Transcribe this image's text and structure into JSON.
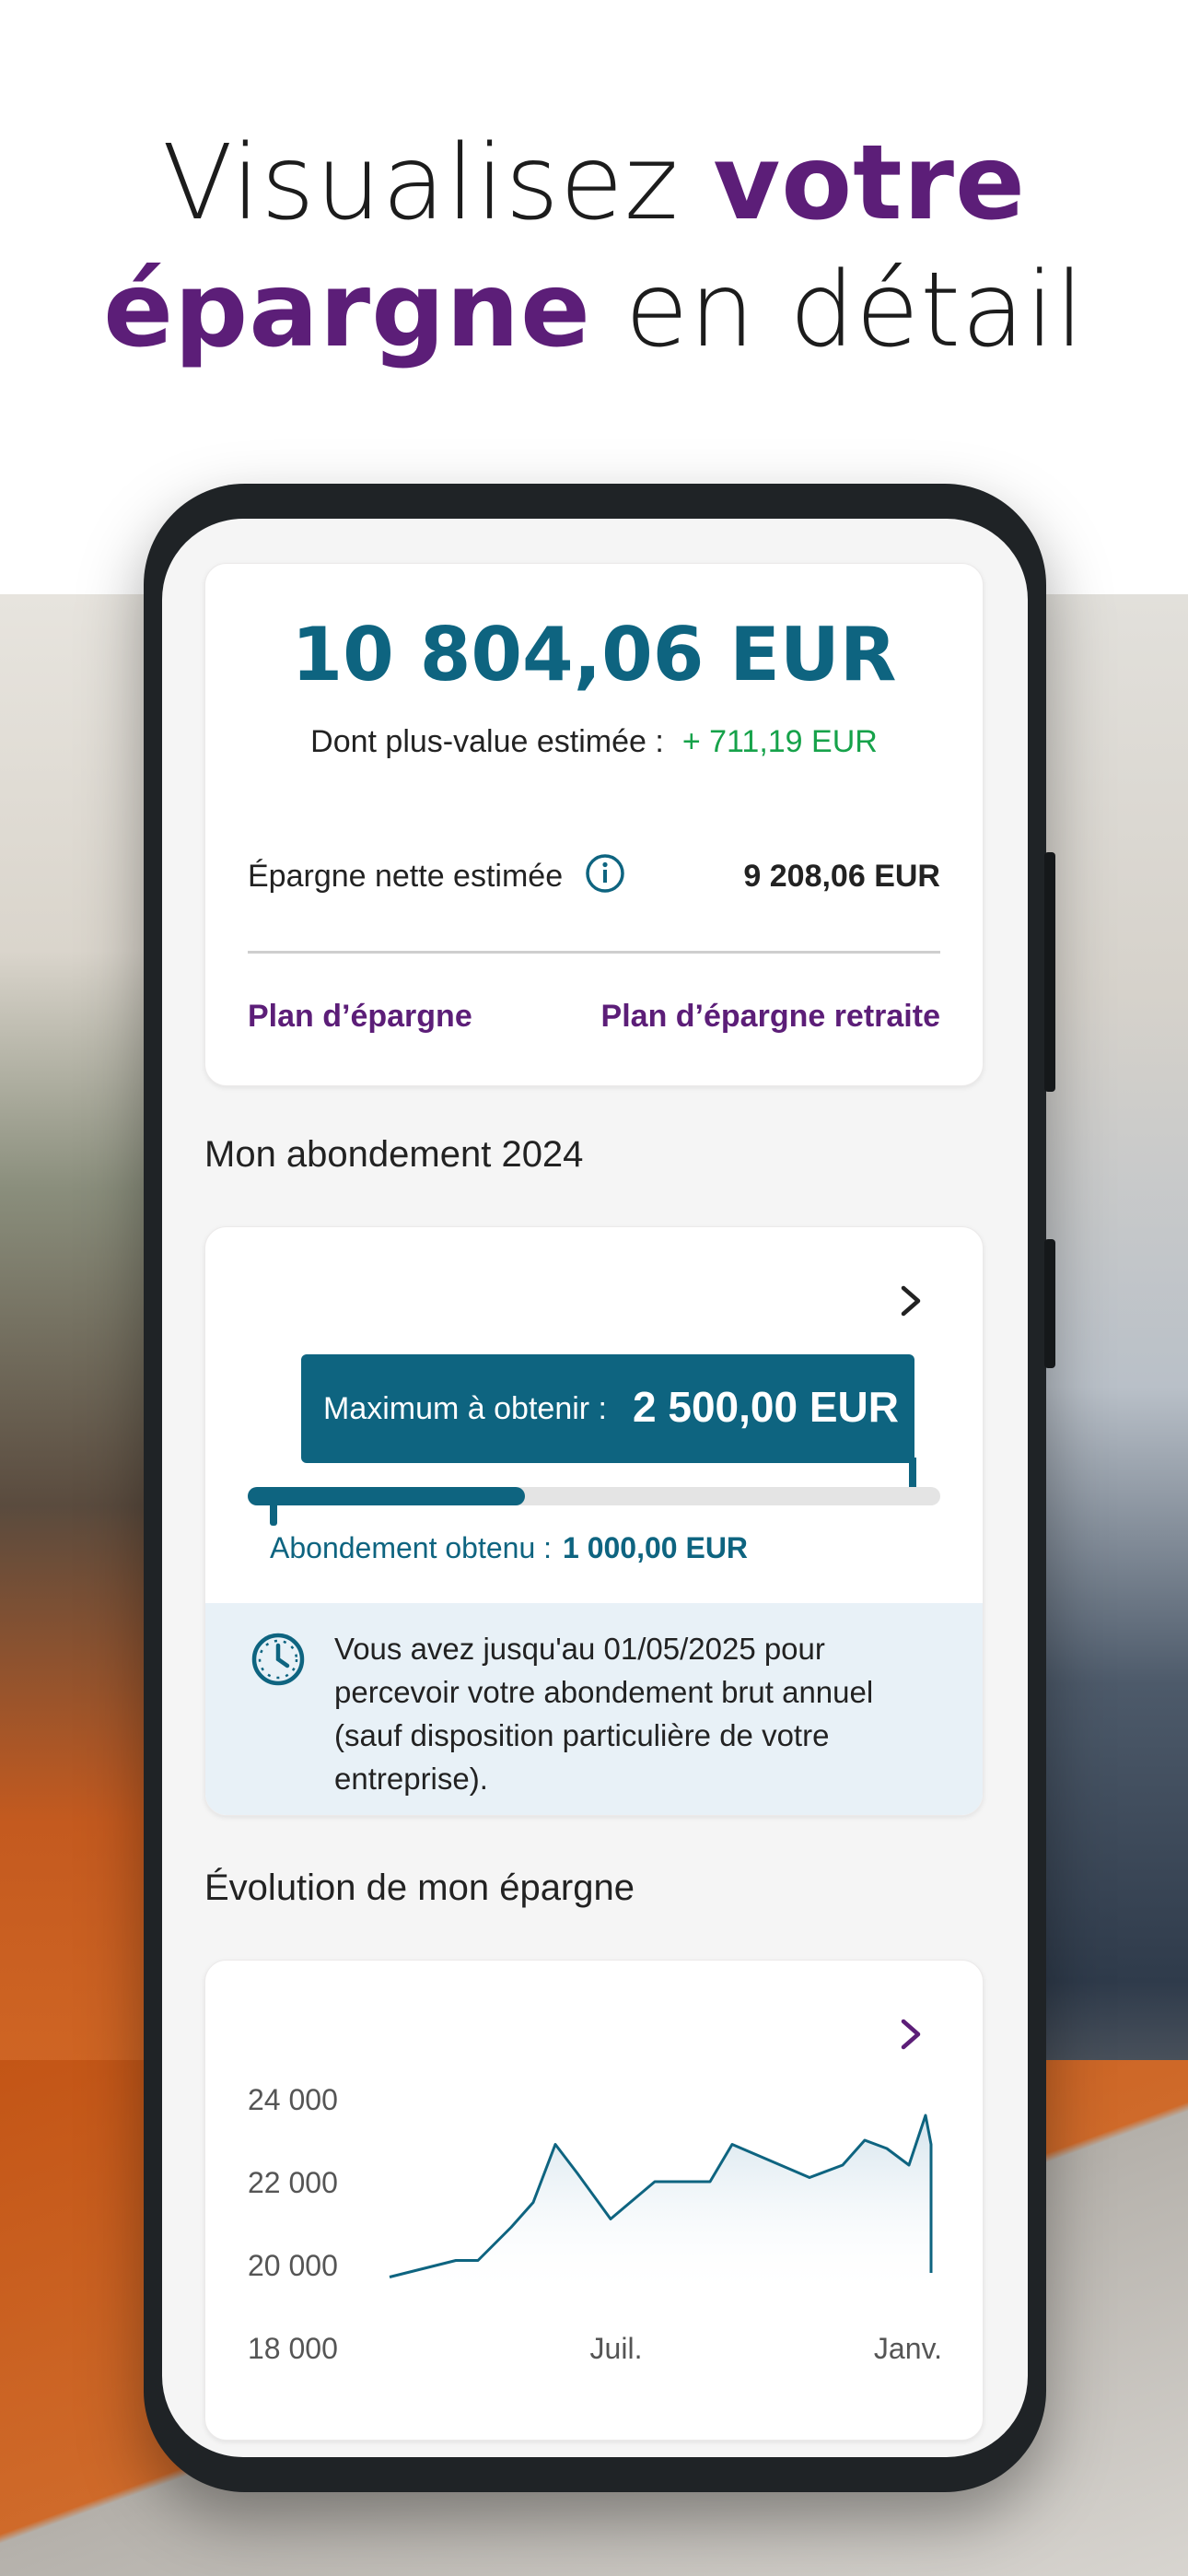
{
  "headline": {
    "part1": "Visualisez ",
    "accent1": "votre",
    "accent2": "épargne",
    "part2": " en détail"
  },
  "colors": {
    "accent_purple": "#5c1e78",
    "teal": "#0e6480",
    "green": "#16a24a"
  },
  "balance": {
    "total": "10 804,06 EUR",
    "gain_label": "Dont plus-value estimée :",
    "gain_value": "+ 711,19 EUR",
    "net_label": "Épargne nette estimée",
    "net_value": "9 208,06 EUR",
    "plan_savings": "Plan d’épargne",
    "plan_retirement": "Plan d’épargne retraite"
  },
  "abondement": {
    "title": "Mon abondement 2024",
    "max_label": "Maximum à obtenir :",
    "max_value": "2 500,00 EUR",
    "obtained_label": "Abondement obtenu :",
    "obtained_value": "1 000,00 EUR",
    "progress_fraction": 0.4,
    "notice": "Vous avez jusqu'au 01/05/2025 pour percevoir votre abondement brut annuel (sauf disposition particulière de votre entreprise)."
  },
  "evolution": {
    "title": "Évolution de mon épargne"
  },
  "chart_data": {
    "type": "area",
    "title": "",
    "xlabel": "",
    "ylabel": "",
    "ylim": [
      18000,
      24000
    ],
    "yticks": [
      "24 000",
      "22 000",
      "20 000",
      "18 000"
    ],
    "xticks": [
      "Juil.",
      "Janv."
    ],
    "grid": false,
    "legend": "none",
    "series": [
      {
        "x": [
          0,
          6,
          12,
          16,
          22,
          26,
          30,
          34,
          40,
          48,
          52,
          58,
          62,
          76,
          82,
          86,
          90,
          94,
          97,
          98
        ],
        "values": [
          19700,
          19900,
          20100,
          20100,
          20900,
          21500,
          22900,
          22200,
          21100,
          22000,
          22000,
          22000,
          22900,
          22100,
          22400,
          23000,
          22800,
          22400,
          23600,
          22900
        ]
      }
    ],
    "last_value_drop": 19800
  }
}
